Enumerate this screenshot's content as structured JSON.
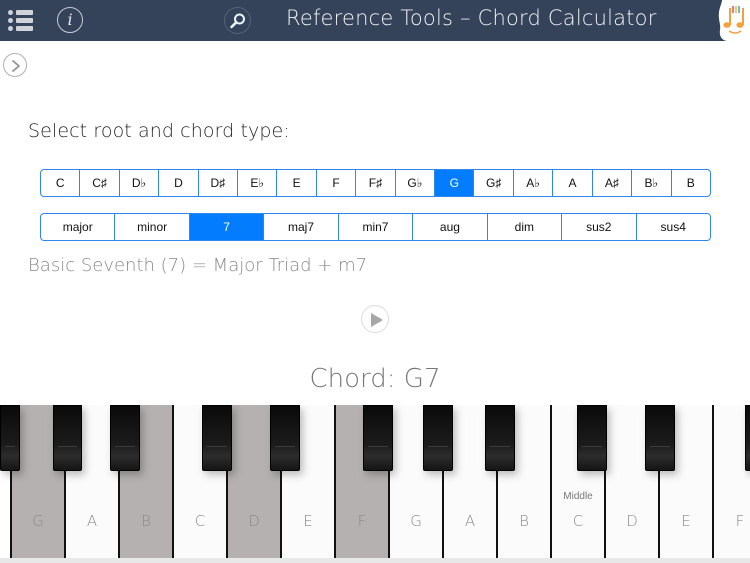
{
  "header": {
    "title": "Reference Tools – Chord Calculator",
    "icons": {
      "menu": "menu-icon",
      "info": "info-icon",
      "info_glyph": "i",
      "search": "search-icon",
      "logo": "music-notes-logo"
    }
  },
  "prompt": "Select root and chord type:",
  "roots": {
    "items": [
      "C",
      "C♯",
      "D♭",
      "D",
      "D♯",
      "E♭",
      "E",
      "F",
      "F♯",
      "G♭",
      "G",
      "G♯",
      "A♭",
      "A",
      "A♯",
      "B♭",
      "B"
    ],
    "selected": "G"
  },
  "chord_types": {
    "items": [
      "major",
      "minor",
      "7",
      "maj7",
      "min7",
      "aug",
      "dim",
      "sus2",
      "sus4"
    ],
    "selected": "7"
  },
  "description": "Basic Seventh (7) = Major Triad + m7",
  "chord_label": "Chord: G7",
  "piano": {
    "white_keys": [
      {
        "note": "G",
        "pressed": true
      },
      {
        "note": "A",
        "pressed": false
      },
      {
        "note": "B",
        "pressed": true
      },
      {
        "note": "C",
        "pressed": false
      },
      {
        "note": "D",
        "pressed": true
      },
      {
        "note": "E",
        "pressed": false
      },
      {
        "note": "F",
        "pressed": true
      },
      {
        "note": "G",
        "pressed": false
      },
      {
        "note": "A",
        "pressed": false
      },
      {
        "note": "B",
        "pressed": false
      },
      {
        "note": "C",
        "pressed": false,
        "sublabel": "Middle"
      },
      {
        "note": "D",
        "pressed": false
      },
      {
        "note": "E",
        "pressed": false
      },
      {
        "note": "F",
        "pressed": false
      }
    ],
    "black_keys": [
      "F♯",
      "G♯",
      "A♯",
      "C♯",
      "D♯",
      "F♯",
      "G♯",
      "A♯",
      "C♯",
      "D♯",
      "F♯"
    ]
  },
  "colors": {
    "header_bg": "#34435a",
    "accent": "#047cfe",
    "pressed_key": "#b5b1b1"
  }
}
